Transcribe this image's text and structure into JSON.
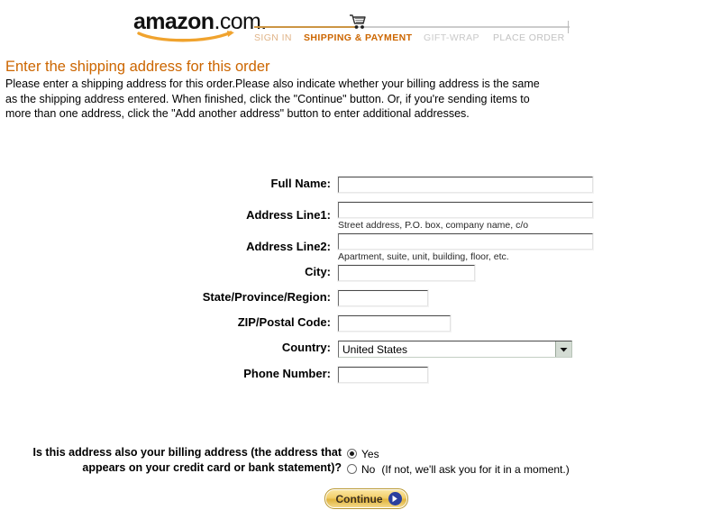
{
  "header": {
    "logo": {
      "brand": "amazon",
      "tld": ".com.",
      "icon": "amazon-swoosh-icon"
    },
    "progress": {
      "cart_icon": "shopping-cart-icon",
      "steps": [
        {
          "label": "SIGN IN",
          "state": "completed"
        },
        {
          "label": "SHIPPING & PAYMENT",
          "state": "active"
        },
        {
          "label": "GIFT-WRAP",
          "state": "upcoming"
        },
        {
          "label": "PLACE ORDER",
          "state": "upcoming"
        }
      ],
      "line_done_color": "#cc9544",
      "line_todo_color": "#cccccc"
    }
  },
  "intro": {
    "title": "Enter the shipping address for this order",
    "description": "Please enter a shipping address for this order.Please also indicate whether your billing address is the same as the shipping address entered. When finished, click the \"Continue\" button.  Or, if you're sending items to more than one address, click the \"Add another address\" button to enter additional addresses."
  },
  "form": {
    "full_name": {
      "label": "Full Name:",
      "value": ""
    },
    "address1": {
      "label": "Address Line1:",
      "value": "",
      "hint": "Street address, P.O. box, company name, c/o"
    },
    "address2": {
      "label": "Address Line2:",
      "value": "",
      "hint": "Apartment, suite, unit, building, floor, etc."
    },
    "city": {
      "label": "City:",
      "value": ""
    },
    "state": {
      "label": "State/Province/Region:",
      "value": ""
    },
    "zip": {
      "label": "ZIP/Postal Code:",
      "value": ""
    },
    "country": {
      "label": "Country:",
      "value": "United States",
      "arrow_icon": "chevron-down-icon"
    },
    "phone": {
      "label": "Phone Number:",
      "value": ""
    }
  },
  "billing": {
    "question_line1": "Is this address also your billing address (the address that",
    "question_line2": "appears on your credit card or bank statement)?",
    "yes_label": "Yes",
    "no_label": "No",
    "no_note": "(If not, we'll ask you for it in a moment.)",
    "selected": "Yes"
  },
  "actions": {
    "continue_label": "Continue",
    "continue_arrow_icon": "arrow-right-circle-icon"
  },
  "colors": {
    "accent_orange": "#cc6600",
    "button_gold": "#e0b43d",
    "arrow_blue": "#2b3f9e"
  }
}
